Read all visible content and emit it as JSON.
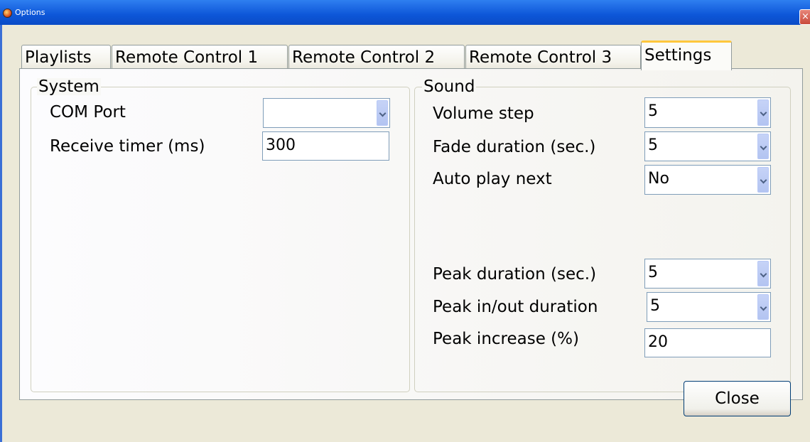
{
  "window": {
    "title": "Options",
    "close_glyph": "×"
  },
  "tabs": [
    {
      "label": "Playlists",
      "active": false
    },
    {
      "label": "Remote Control 1",
      "active": false
    },
    {
      "label": "Remote Control 2",
      "active": false
    },
    {
      "label": "Remote Control 3",
      "active": false
    },
    {
      "label": "Settings",
      "active": true
    }
  ],
  "system": {
    "legend": "System",
    "com_port_label": "COM Port",
    "com_port_value": "",
    "receive_timer_label": "Receive timer (ms)",
    "receive_timer_value": "300"
  },
  "sound": {
    "legend": "Sound",
    "volume_step_label": "Volume step",
    "volume_step_value": "5",
    "fade_duration_label": "Fade duration (sec.)",
    "fade_duration_value": "5",
    "auto_play_next_label": "Auto play next",
    "auto_play_next_value": "No",
    "peak_duration_label": "Peak duration (sec.)",
    "peak_duration_value": "5",
    "peak_inout_label": "Peak in/out duration",
    "peak_inout_value": "5",
    "peak_increase_label": "Peak increase (%)",
    "peak_increase_value": "20"
  },
  "buttons": {
    "close_label": "Close"
  },
  "colors": {
    "titlebar": "#0d56d8",
    "dialog_bg": "#ece9d8",
    "active_tab_accent": "#ffc73c",
    "field_border": "#7f9db9"
  }
}
